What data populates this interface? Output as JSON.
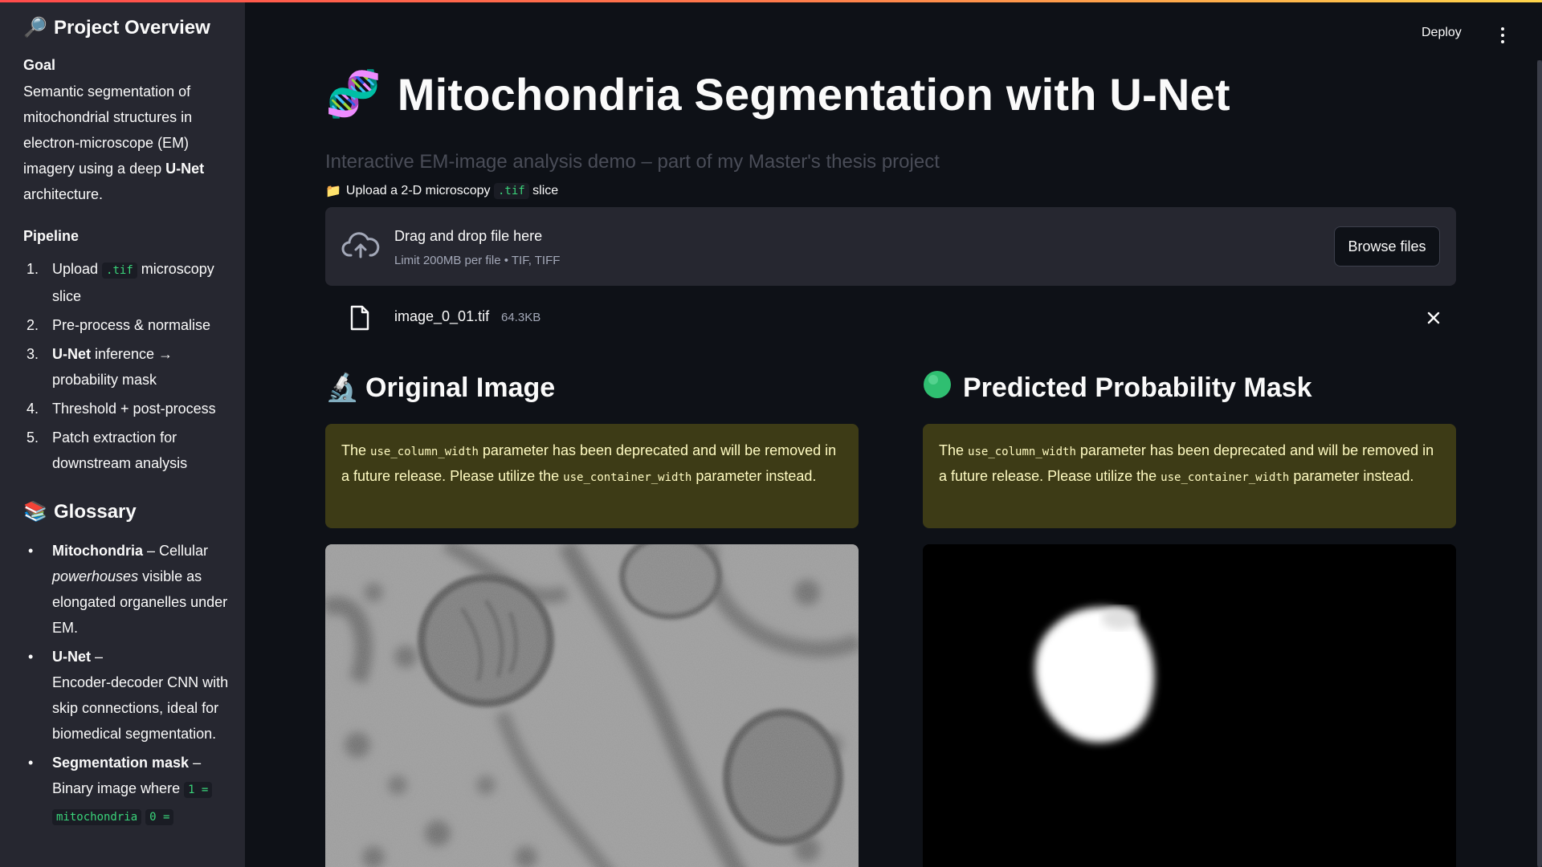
{
  "sidebar": {
    "title": "Project Overview",
    "goal_heading": "Goal",
    "goal_text_before": "Semantic segmentation of mitochondrial structures in electron-microscope (EM) imagery using a deep ",
    "goal_text_bold": "U-Net",
    "goal_text_after": " architecture.",
    "pipeline_heading": "Pipeline",
    "pipeline": [
      {
        "num": "1.",
        "pre": "Upload ",
        "code": ".tif",
        "post": " microscopy slice",
        "bold": ""
      },
      {
        "num": "2.",
        "pre": "Pre-process & normalise",
        "code": "",
        "post": "",
        "bold": ""
      },
      {
        "num": "3.",
        "pre": "",
        "code": "",
        "post": " inference → probability mask",
        "bold": "U-Net"
      },
      {
        "num": "4.",
        "pre": "Threshold + post-process",
        "code": "",
        "post": "",
        "bold": ""
      },
      {
        "num": "5.",
        "pre": "Patch extraction for downstream analysis",
        "code": "",
        "post": "",
        "bold": ""
      }
    ],
    "glossary_heading": "Glossary",
    "glossary": [
      {
        "bold": "Mitochondria",
        "dash": " – Cellular ",
        "italic": "powerhouses",
        "rest": " visible as elongated organelles under EM."
      },
      {
        "bold": "U-Net",
        "dash": " – ",
        "italic": "",
        "rest": "Encoder-decoder CNN with skip connections, ideal for biomedical segmentation."
      },
      {
        "bold": "Segmentation mask",
        "dash": " – ",
        "italic": "",
        "rest": "Binary image where "
      }
    ],
    "glossary_code_1": "1 =",
    "glossary_code_2": "mitochondria",
    "glossary_code_3": "0 ="
  },
  "header": {
    "deploy_label": "Deploy",
    "menu_icon": "kebab-menu-icon"
  },
  "main": {
    "title": "Mitochondria Segmentation with U-Net",
    "title_emoji": "🧬",
    "subtitle": "Interactive EM-image analysis demo – part of my Master's thesis project",
    "upload_label_pre": "Upload a 2-D microscopy ",
    "upload_label_code": ".tif",
    "upload_label_post": " slice",
    "dropzone_main": "Drag and drop file here",
    "dropzone_sub": "Limit 200MB per file • TIF, TIFF",
    "browse_label": "Browse files",
    "file_name": "image_0_01.tif",
    "file_size": "64.3KB"
  },
  "columns": {
    "left_title": "Original Image",
    "left_emoji": "🔬",
    "right_title": "Predicted Probability Mask",
    "right_emoji": "🟢",
    "warning_pre": "The ",
    "warning_code1": "use_column_width",
    "warning_mid": " parameter has been deprecated and will be removed in a future release. Please utilize the ",
    "warning_code2": "use_container_width",
    "warning_post": " parameter instead."
  },
  "colors": {
    "background": "#0e1117",
    "sidebar": "#262730",
    "warning_bg": "#3d3b16",
    "warning_text": "#fffbc2",
    "code_green": "#3ad47a"
  }
}
